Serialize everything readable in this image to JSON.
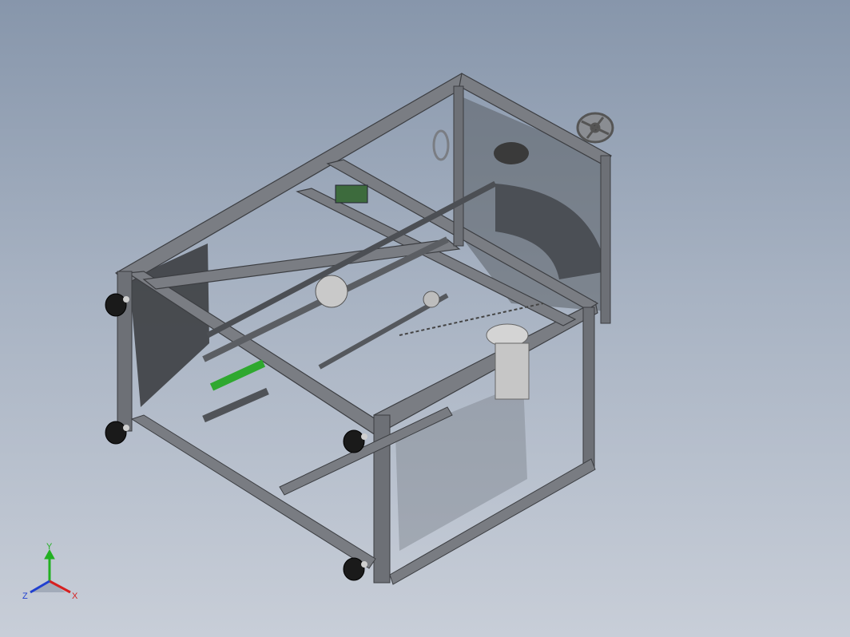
{
  "triad": {
    "x_label": "X",
    "y_label": "Y",
    "z_label": "Z",
    "x_color": "#d62020",
    "y_color": "#22b022",
    "z_color": "#2040d0"
  },
  "model": {
    "frame_color": "#6f7277",
    "accent_color": "#2fa82f",
    "motor_color": "#c9c9c9",
    "foot_color": "#1a1a1a"
  }
}
